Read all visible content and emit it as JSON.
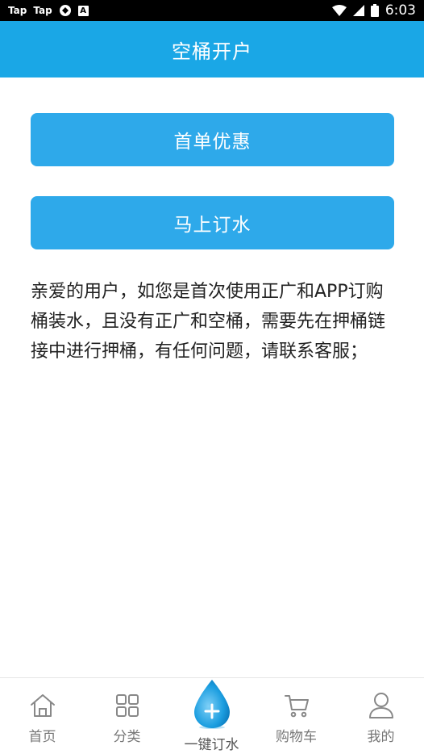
{
  "status_bar": {
    "left_items": [
      "Tap",
      "Tap"
    ],
    "time": "6:03",
    "icons": [
      "app-icon",
      "accessibility-icon",
      "wifi-icon",
      "signal-icon",
      "battery-icon"
    ]
  },
  "header": {
    "title": "空桶开户"
  },
  "buttons": {
    "first_order": "首单优惠",
    "order_now": "马上订水"
  },
  "notice": {
    "text": "亲爱的用户，如您是首次使用正广和APP订购桶装水，且没有正广和空桶，需要先在押桶链接中进行押桶，有任何问题，请联系客服；"
  },
  "tab_bar": {
    "home": "首页",
    "category": "分类",
    "one_click_order": "一键订水",
    "cart": "购物车",
    "mine": "我的"
  },
  "colors": {
    "header_bg": "#1aa7e6",
    "button_bg": "#2ea9ea",
    "tab_inactive": "#777777"
  }
}
